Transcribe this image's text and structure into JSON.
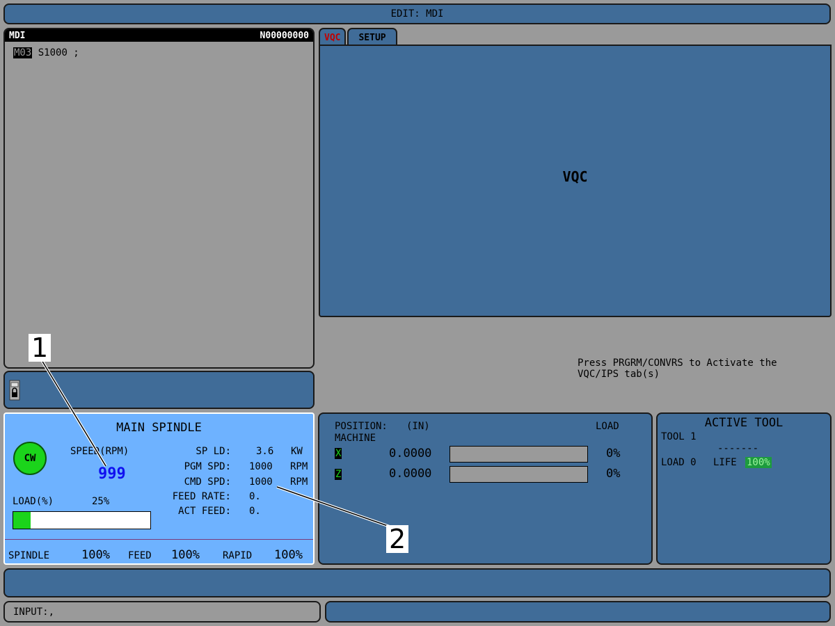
{
  "top_bar": {
    "title": "EDIT: MDI"
  },
  "mdi": {
    "title": "MDI",
    "program_number": "N00000000",
    "cursor_word": "M03",
    "line_rest": " S1000 ;"
  },
  "tabs": [
    {
      "label": "VQC",
      "active": true
    },
    {
      "label": "SETUP",
      "active": false
    }
  ],
  "vqc": {
    "center_label": "VQC",
    "message": "Press PRGRM/CONVRS to Activate the\nVQC/IPS tab(s)"
  },
  "lock": {
    "icon": "lock-icon"
  },
  "spindle": {
    "title": "MAIN SPINDLE",
    "direction": "CW",
    "speed_label": "SPEED(RPM)",
    "speed_value": "999",
    "load_label": "LOAD(%)",
    "load_value": "25%",
    "load_fraction": 0.125,
    "stats": [
      {
        "label": "SP LD:",
        "value": "3.6",
        "unit": "KW"
      },
      {
        "label": "PGM SPD:",
        "value": "1000",
        "unit": "RPM"
      },
      {
        "label": "CMD SPD:",
        "value": "1000",
        "unit": "RPM"
      },
      {
        "label": "FEED RATE:",
        "value": "0.",
        "unit": ""
      },
      {
        "label": "ACT FEED:",
        "value": "0.",
        "unit": ""
      }
    ],
    "overrides": {
      "spindle_label": "SPINDLE",
      "spindle_value": "100%",
      "feed_label": "FEED",
      "feed_value": "100%",
      "rapid_label": "RAPID",
      "rapid_value": "100%"
    }
  },
  "position": {
    "title": "POSITION:",
    "units": "(IN)",
    "mode": "MACHINE",
    "load_header": "LOAD",
    "axes": [
      {
        "axis": "X",
        "value": "0.0000",
        "load": "0%"
      },
      {
        "axis": "Z",
        "value": "0.0000",
        "load": "0%"
      }
    ]
  },
  "active_tool": {
    "title": "ACTIVE TOOL",
    "tool_label": "TOOL 1",
    "tool_desc": "-------",
    "load_label": "LOAD 0",
    "life_label": "LIFE",
    "life_value": "100%"
  },
  "input": {
    "label": "INPUT:",
    "value": ","
  },
  "callouts": [
    {
      "number": "1"
    },
    {
      "number": "2"
    }
  ],
  "colors": {
    "background": "#9a9a9a",
    "panel_blue": "#406c98",
    "spindle_blue": "#6eb2ff",
    "green": "#1bd41b",
    "speed_blue": "#1010f0",
    "active_tab": "#c00000"
  }
}
